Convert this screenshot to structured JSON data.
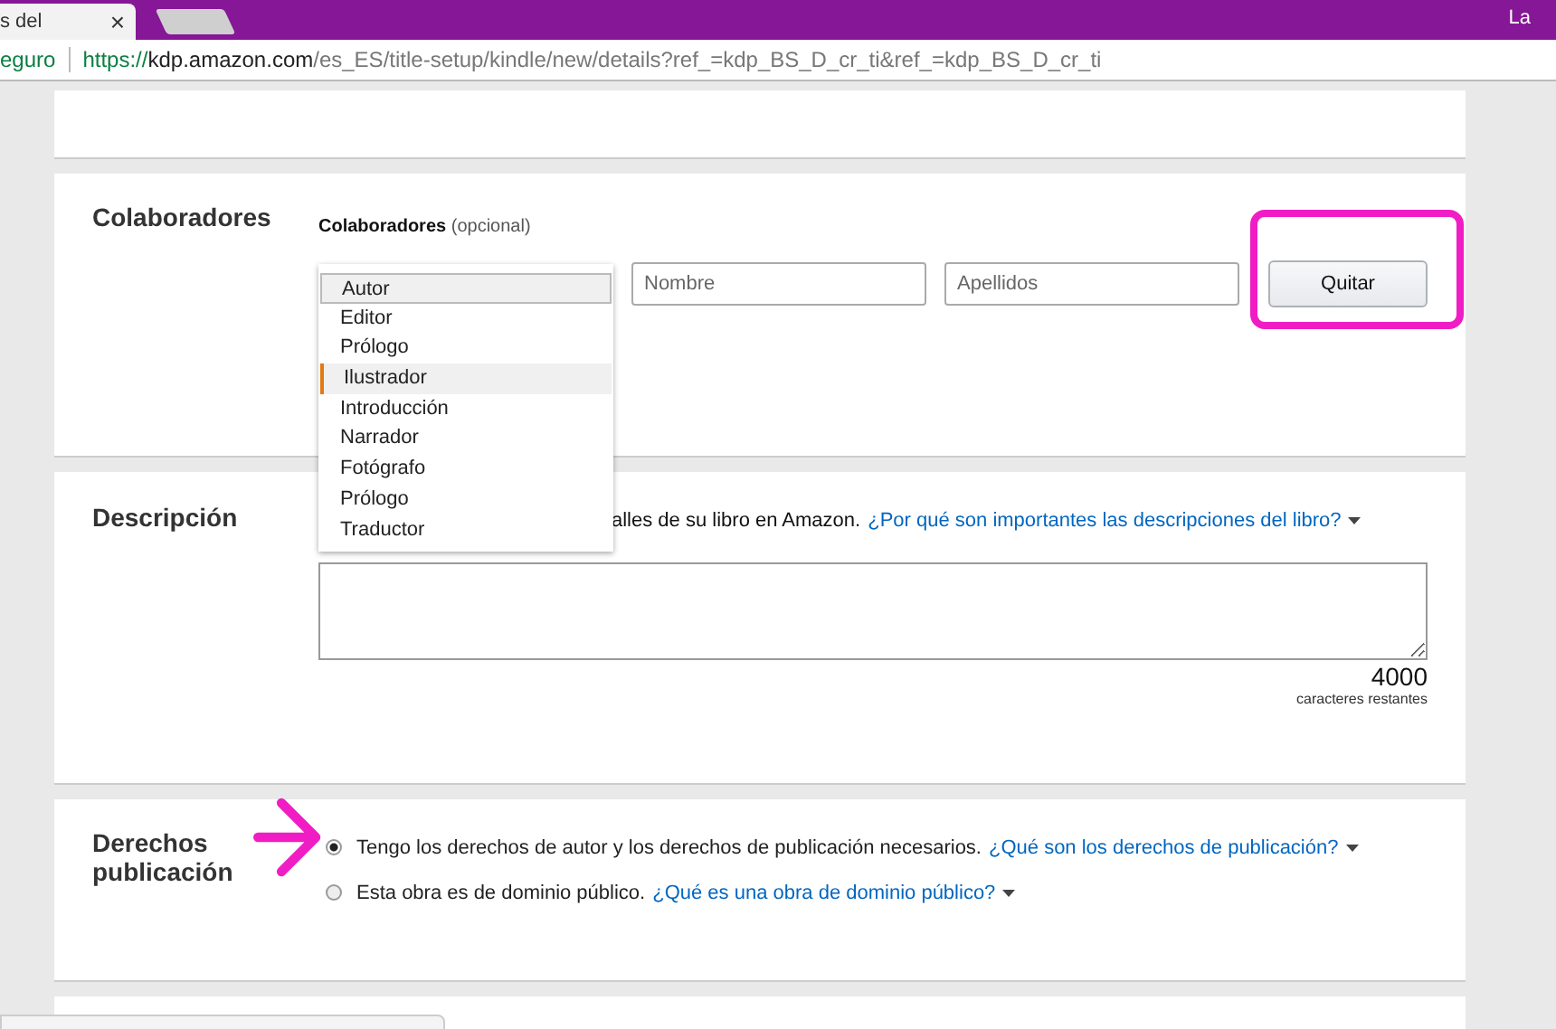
{
  "browser": {
    "tab": {
      "title": "s del",
      "close": "×"
    },
    "profile": "La",
    "address": {
      "security": "eguro",
      "url": {
        "scheme": "https://",
        "host": "kdp.amazon.com",
        "path": "/es_ES/title-setup/kindle/new/details?ref_=kdp_BS_D_cr_ti&ref_=kdp_BS_D_cr_ti"
      }
    }
  },
  "sections": [
    {
      "kind": "blank"
    },
    {
      "kind": "contributors",
      "heading": "Colaboradores",
      "label": "Colaboradores",
      "label_note": "(opcional)",
      "first_name": {
        "placeholder": "Nombre"
      },
      "last_name": {
        "placeholder": "Apellidos"
      },
      "remove_button": "Quitar",
      "highlighted": true,
      "role_menu": [
        {
          "label": "Autor",
          "selected": true,
          "hovered": false
        },
        {
          "label": "Editor",
          "selected": false,
          "hovered": false
        },
        {
          "label": "Prólogo",
          "selected": false,
          "hovered": false
        },
        {
          "label": "Ilustrador",
          "selected": false,
          "hovered": true
        },
        {
          "label": "Introducción",
          "selected": false,
          "hovered": false
        },
        {
          "label": "Narrador",
          "selected": false,
          "hovered": false
        },
        {
          "label": "Fotógrafo",
          "selected": false,
          "hovered": false
        },
        {
          "label": "Prólogo",
          "selected": false,
          "hovered": false
        },
        {
          "label": "Traductor",
          "selected": false,
          "hovered": false
        }
      ]
    },
    {
      "kind": "description",
      "heading": "Descripción",
      "intro": "alles de su libro en Amazon.",
      "help_link": "¿Por qué son importantes las descripciones del libro?",
      "counter": "4000",
      "counter_label": "caracteres restantes"
    },
    {
      "kind": "rights",
      "heading_lines": [
        "Derechos",
        "publicación"
      ],
      "pointer_arrow": true,
      "options": [
        {
          "label": "Tengo los derechos de autor y los derechos de publicación necesarios.",
          "link": "¿Qué son los derechos de publicación?",
          "selected": true
        },
        {
          "label": "Esta obra es de dominio público.",
          "link": "¿Qué es una obra de dominio público?",
          "selected": false
        }
      ]
    },
    {
      "kind": "blank"
    }
  ]
}
